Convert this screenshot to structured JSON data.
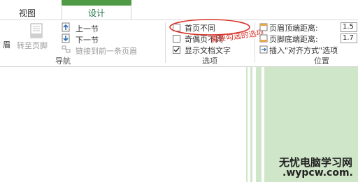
{
  "tabs": {
    "view": "视图",
    "design": "设计"
  },
  "nav": {
    "header_partial": "眉",
    "goto_footer": "转至页脚",
    "prev_section": "上一节",
    "next_section": "下一节",
    "link_previous": "链接到前一条页眉",
    "group_label": "导航"
  },
  "options": {
    "different_first_page": "首页不同",
    "different_odd_even": "奇偶页不同",
    "show_document_text": "显示文档文字",
    "group_label": "选项",
    "annotation": "需要勾选的选项"
  },
  "position": {
    "header_from_top": "页眉顶端距离:",
    "header_from_top_value": "1.5",
    "footer_from_bottom": "页脚底端距离:",
    "footer_from_bottom_value": "1.7",
    "insert_alignment_tab": "插入\"对齐方式\"选项",
    "group_label": "位置"
  },
  "watermark": {
    "line1": "无忧电脑学习网",
    "line2": ".wypcw.com."
  },
  "colors": {
    "accent_green": "#4e9a45",
    "page_green": "#cfe6c8",
    "annotation_red": "#d9342b"
  }
}
